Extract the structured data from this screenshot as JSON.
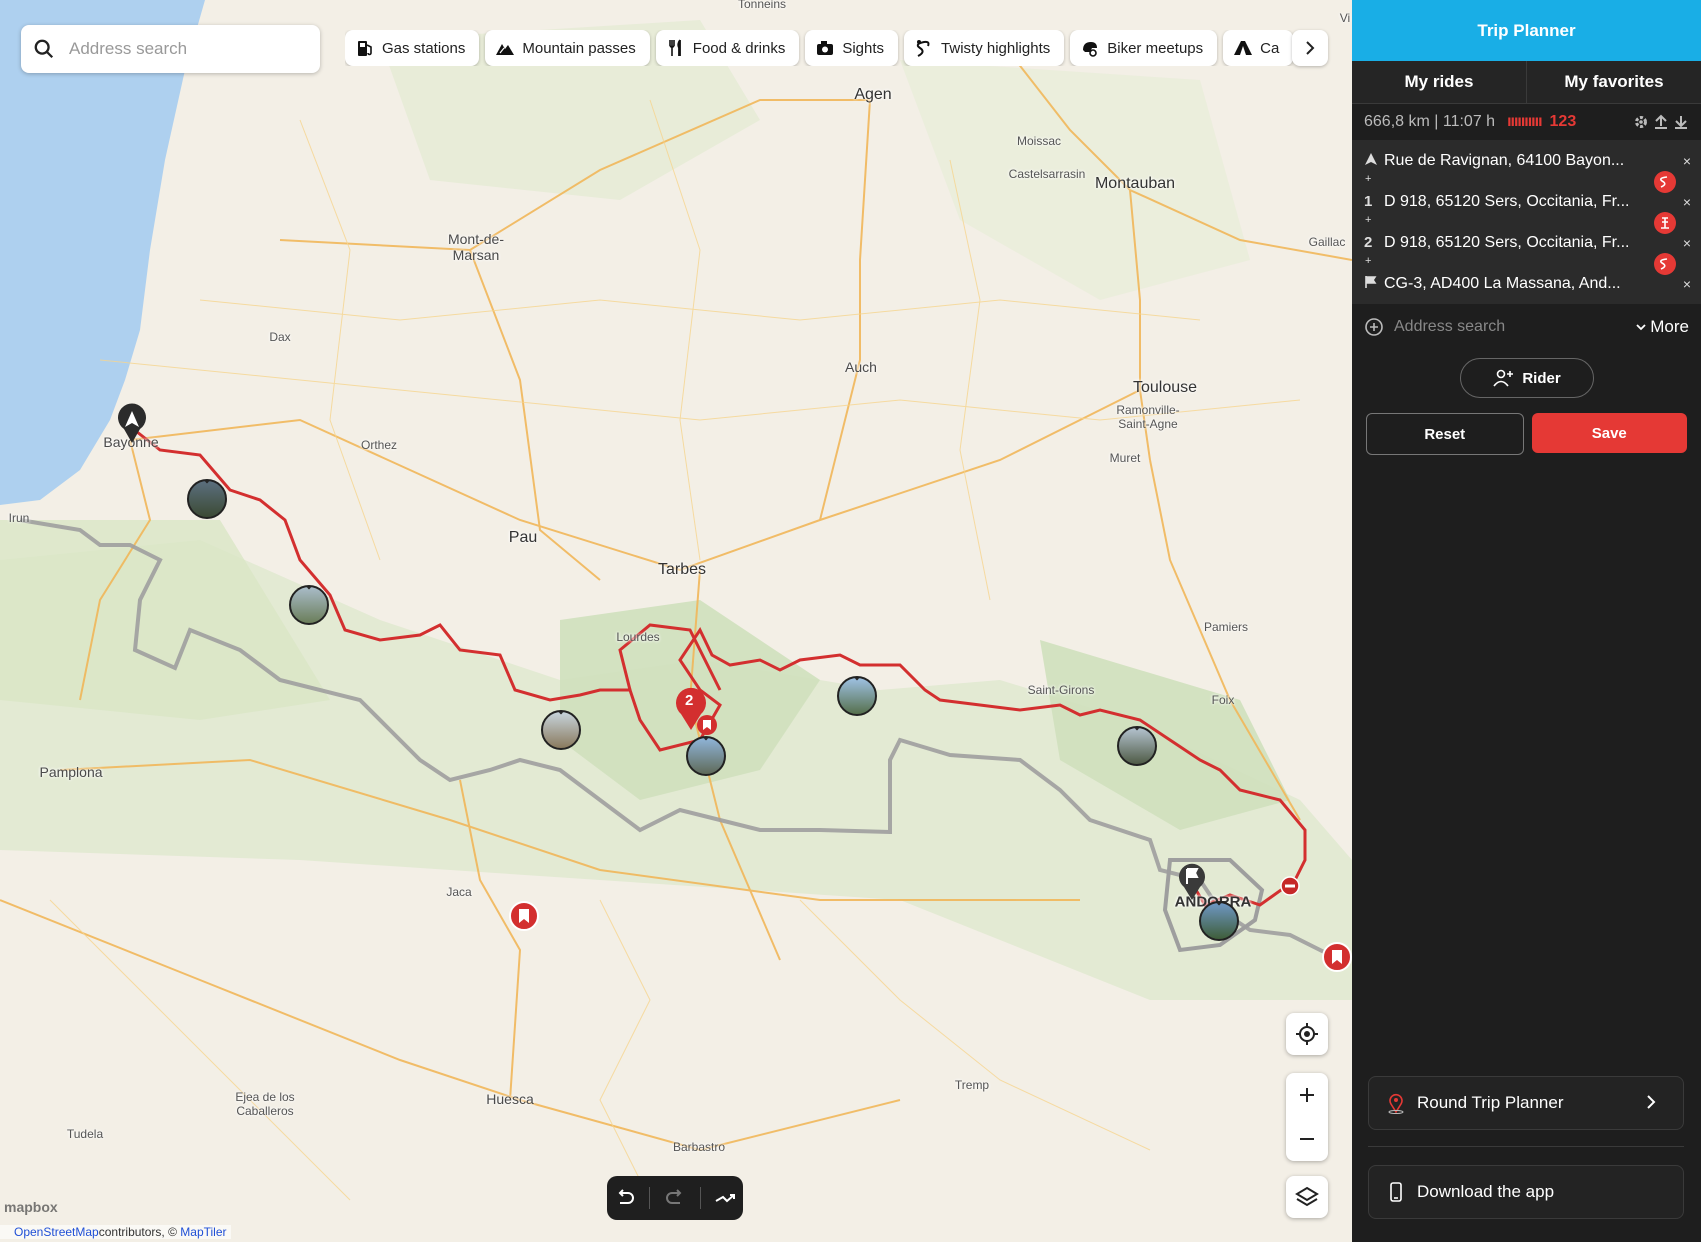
{
  "map": {
    "search_placeholder": "Address search",
    "chips": [
      {
        "label": "Gas stations",
        "icon": "gas-station-icon"
      },
      {
        "label": "Mountain passes",
        "icon": "mountain-icon"
      },
      {
        "label": "Food & drinks",
        "icon": "fork-knife-icon"
      },
      {
        "label": "Sights",
        "icon": "camera-icon"
      },
      {
        "label": "Twisty highlights",
        "icon": "twisty-road-icon"
      },
      {
        "label": "Biker meetups",
        "icon": "biker-icon"
      },
      {
        "label": "Ca",
        "icon": "tent-icon"
      }
    ],
    "place_labels": {
      "tonneins": "Tonneins",
      "agen": "Agen",
      "moissac": "Moissac",
      "castelsarrasin": "Castelsarrasin",
      "montauban": "Montauban",
      "gaillac": "Gaillac",
      "mont_de_marsan": "Mont-de-\nMarsan",
      "dax": "Dax",
      "auch": "Auch",
      "toulouse": "Toulouse",
      "ramonville": "Ramonville-\nSaint-Agne",
      "bayonne": "Bayonne",
      "orthez": "Orthez",
      "irun": "Irun",
      "pau": "Pau",
      "muret": "Muret",
      "tarbes": "Tarbes",
      "lourdes": "Lourdes",
      "pamiers": "Pamiers",
      "saint_girons": "Saint-Girons",
      "foix": "Foix",
      "pamplona": "Pamplona",
      "jaca": "Jaca",
      "andorra": "ANDORRA",
      "tremp": "Tremp",
      "huesca": "Huesca",
      "ejea": "Ejea de los\nCaballeros",
      "tudela": "Tudela",
      "barbastro": "Barbastro",
      "vi": "Vi"
    },
    "cluster_count": "2",
    "attribution": {
      "prefix": "©",
      "osm": "OpenStreetMap",
      "contributors": "contributors, ©",
      "maptiler": "MapTiler"
    },
    "mapbox": "mapbox",
    "colors": {
      "route": "#d32f2f",
      "border": "#9e9e9e",
      "accent": "#19aee6",
      "save": "#e53935"
    }
  },
  "panel": {
    "title": "Trip Planner",
    "tabs": [
      "My rides",
      "My favorites"
    ],
    "stats": {
      "distance_time": "666,8 km | 11:07 h",
      "bars": "ıııııııııı",
      "score": "123"
    },
    "waypoints": [
      {
        "lead": "",
        "text": "Rue de Ravignan, 64100 Bayon..."
      },
      {
        "lead": "1",
        "text": "D 918, 65120 Sers, Occitania, Fr..."
      },
      {
        "lead": "2",
        "text": "D 918, 65120 Sers, Occitania, Fr..."
      },
      {
        "lead": "",
        "text": "CG-3, AD400 La Massana, And..."
      }
    ],
    "remove": "×",
    "plus": "+",
    "address_placeholder": "Address search",
    "more": "More",
    "rider": "Rider",
    "reset": "Reset",
    "save": "Save",
    "round_trip": "Round Trip Planner",
    "download": "Download the app"
  }
}
